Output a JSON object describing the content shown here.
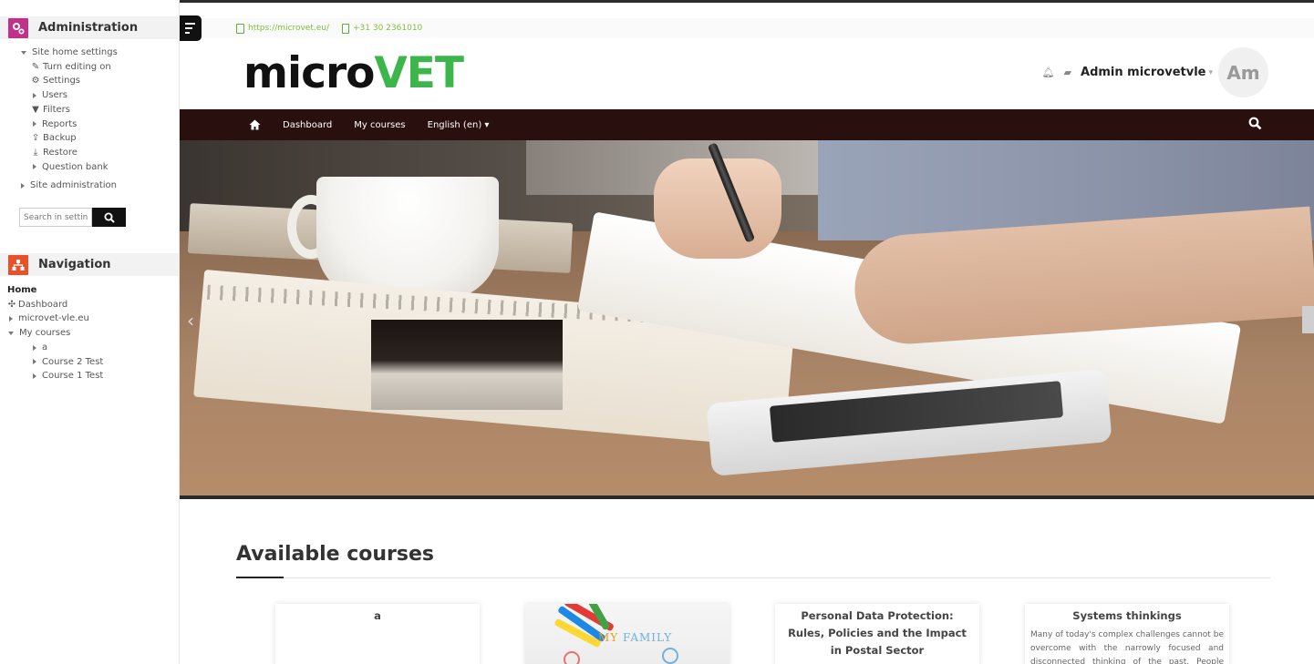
{
  "administration": {
    "title": "Administration",
    "items": [
      {
        "label": "Site home settings"
      },
      {
        "label": "Turn editing on"
      },
      {
        "label": "Settings"
      },
      {
        "label": "Users"
      },
      {
        "label": "Filters"
      },
      {
        "label": "Reports"
      },
      {
        "label": "Backup"
      },
      {
        "label": "Restore"
      },
      {
        "label": "Question bank"
      },
      {
        "label": "Site administration"
      }
    ],
    "search_placeholder": "Search in settings"
  },
  "navigation": {
    "title": "Navigation",
    "home": "Home",
    "items": [
      {
        "label": "Dashboard"
      },
      {
        "label": "microvet-vle.eu"
      },
      {
        "label": "My courses"
      },
      {
        "label": "a"
      },
      {
        "label": "Course 2 Test"
      },
      {
        "label": "Course 1 Test"
      }
    ]
  },
  "contact": {
    "website": "https://microvet.eu/",
    "phone": "+31 30 2361010"
  },
  "brand": {
    "part1": "micro",
    "part2": "VET"
  },
  "user": {
    "name": "Admin microvetvle",
    "avatar_initials": "Am"
  },
  "navbar": {
    "links": [
      "Dashboard",
      "My courses",
      "English (en)"
    ]
  },
  "courses": {
    "heading": "Available courses",
    "cards": [
      {
        "title": "a",
        "summary": ""
      },
      {
        "title": "",
        "image_text_1": "MY ",
        "image_text_2": "FAMILY"
      },
      {
        "title": "Personal Data Protection: Rules, Policies and the Impact in Postal Sector",
        "summary": ""
      },
      {
        "title": "Systems thinkings",
        "summary": "Many of today's complex challenges cannot be overcome with the narrowly focused and disconnected thinking of the past. People must"
      }
    ]
  },
  "colors": {
    "brand_green": "#3cb54a",
    "navbar_bg": "#2a0f0f",
    "admin_icon": "#c0328a",
    "nav_icon": "#e8522b"
  }
}
